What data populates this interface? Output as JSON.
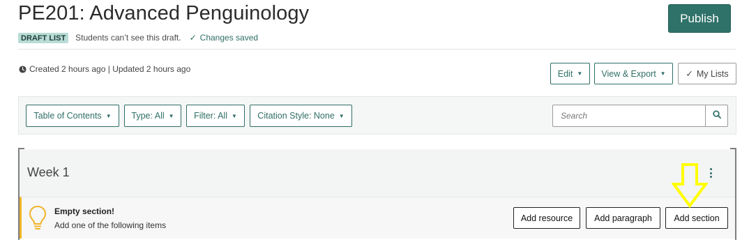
{
  "page": {
    "title": "PE201: Advanced Penguinology",
    "badge": "DRAFT LIST",
    "draft_note": "Students can’t see this draft.",
    "saved_status": "Changes saved",
    "publish_label": "Publish"
  },
  "meta": {
    "created_updated": "Created 2 hours ago | Updated 2 hours ago"
  },
  "actions": {
    "edit": "Edit",
    "view_export": "View & Export",
    "my_lists": "My Lists"
  },
  "toolbar": {
    "toc": "Table of Contents",
    "type": "Type: All",
    "filter": "Filter: All",
    "citation": "Citation Style: None",
    "search_placeholder": "Search"
  },
  "section": {
    "title": "Week 1",
    "empty_title": "Empty section!",
    "empty_sub": "Add one of the following items",
    "add_resource": "Add resource",
    "add_paragraph": "Add paragraph",
    "add_section": "Add section"
  },
  "colors": {
    "accent": "#2f7269",
    "badge_bg": "#b9dcd6",
    "warning": "#f0b429",
    "highlight_arrow": "#ffff00"
  },
  "icons": [
    "clock-icon",
    "check-icon",
    "caret-down-icon",
    "search-icon",
    "kebab-menu-icon",
    "lightbulb-icon",
    "arrow-down-icon"
  ]
}
